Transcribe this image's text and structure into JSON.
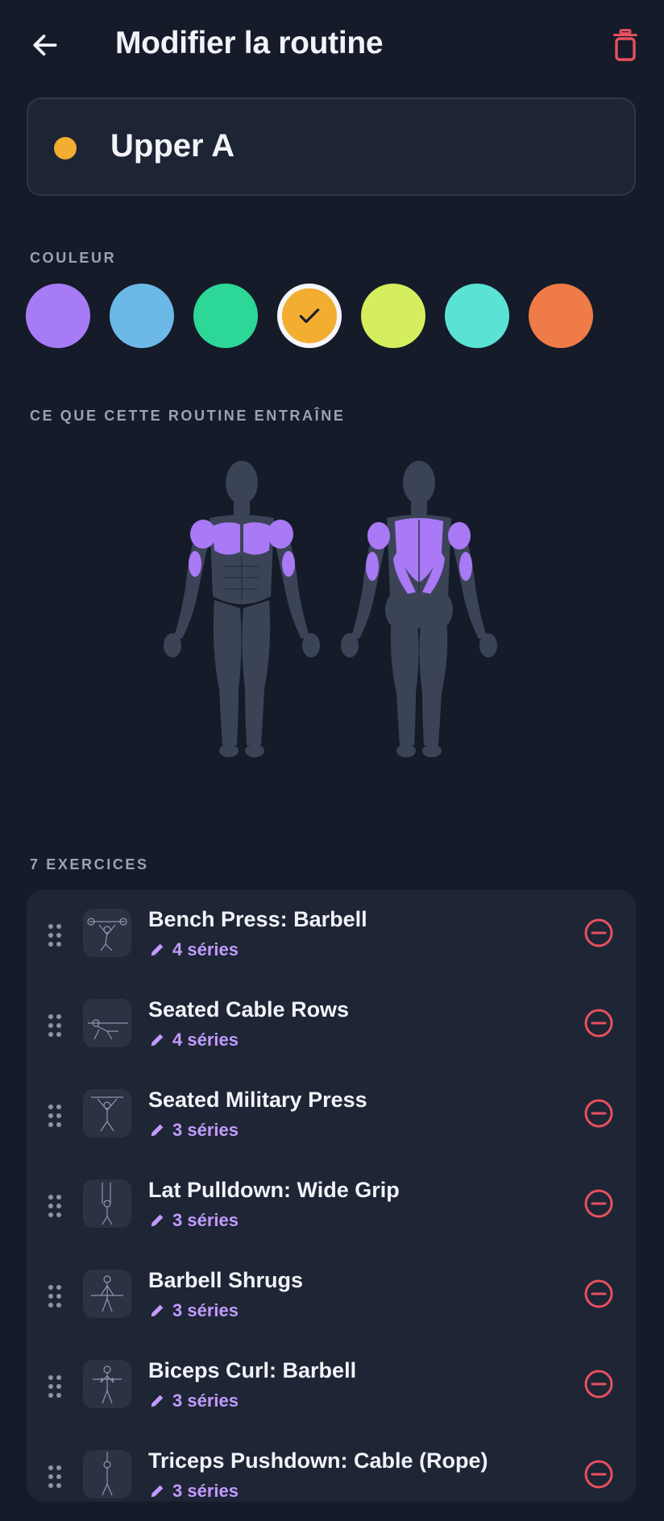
{
  "header": {
    "title": "Modifier la routine",
    "back_icon": "arrow-left-icon",
    "delete_icon": "trash-icon",
    "delete_color": "#e8505f"
  },
  "routine": {
    "name": "Upper A",
    "color": "#f3ad30"
  },
  "color_section": {
    "label": "COULEUR",
    "swatches": [
      {
        "color": "#a77bf5",
        "selected": false
      },
      {
        "color": "#6cb9e8",
        "selected": false
      },
      {
        "color": "#2dd798",
        "selected": false
      },
      {
        "color": "#f3ad30",
        "selected": true
      },
      {
        "color": "#d4ee5d",
        "selected": false
      },
      {
        "color": "#5ae3d5",
        "selected": false
      },
      {
        "color": "#ef7b48",
        "selected": false
      }
    ]
  },
  "muscles_section": {
    "label": "CE QUE CETTE ROUTINE ENTRAÎNE",
    "highlight_color": "#a979f6",
    "base_color": "#3b4457",
    "front_highlighted": [
      "chest",
      "shoulders",
      "biceps"
    ],
    "back_highlighted": [
      "traps",
      "lats",
      "rear-delts",
      "triceps"
    ]
  },
  "exercises_section": {
    "label": "7 EXERCICES",
    "items": [
      {
        "name": "Bench Press: Barbell",
        "sets": "4 séries"
      },
      {
        "name": "Seated Cable Rows",
        "sets": "4 séries"
      },
      {
        "name": "Seated Military Press",
        "sets": "3 séries"
      },
      {
        "name": "Lat Pulldown: Wide Grip",
        "sets": "3 séries"
      },
      {
        "name": "Barbell Shrugs",
        "sets": "3 séries"
      },
      {
        "name": "Biceps Curl: Barbell",
        "sets": "3 séries"
      },
      {
        "name": "Triceps Pushdown: Cable (Rope)",
        "sets": "3 séries"
      }
    ],
    "accent_color": "#c39bff",
    "remove_color": "#e8505f"
  }
}
